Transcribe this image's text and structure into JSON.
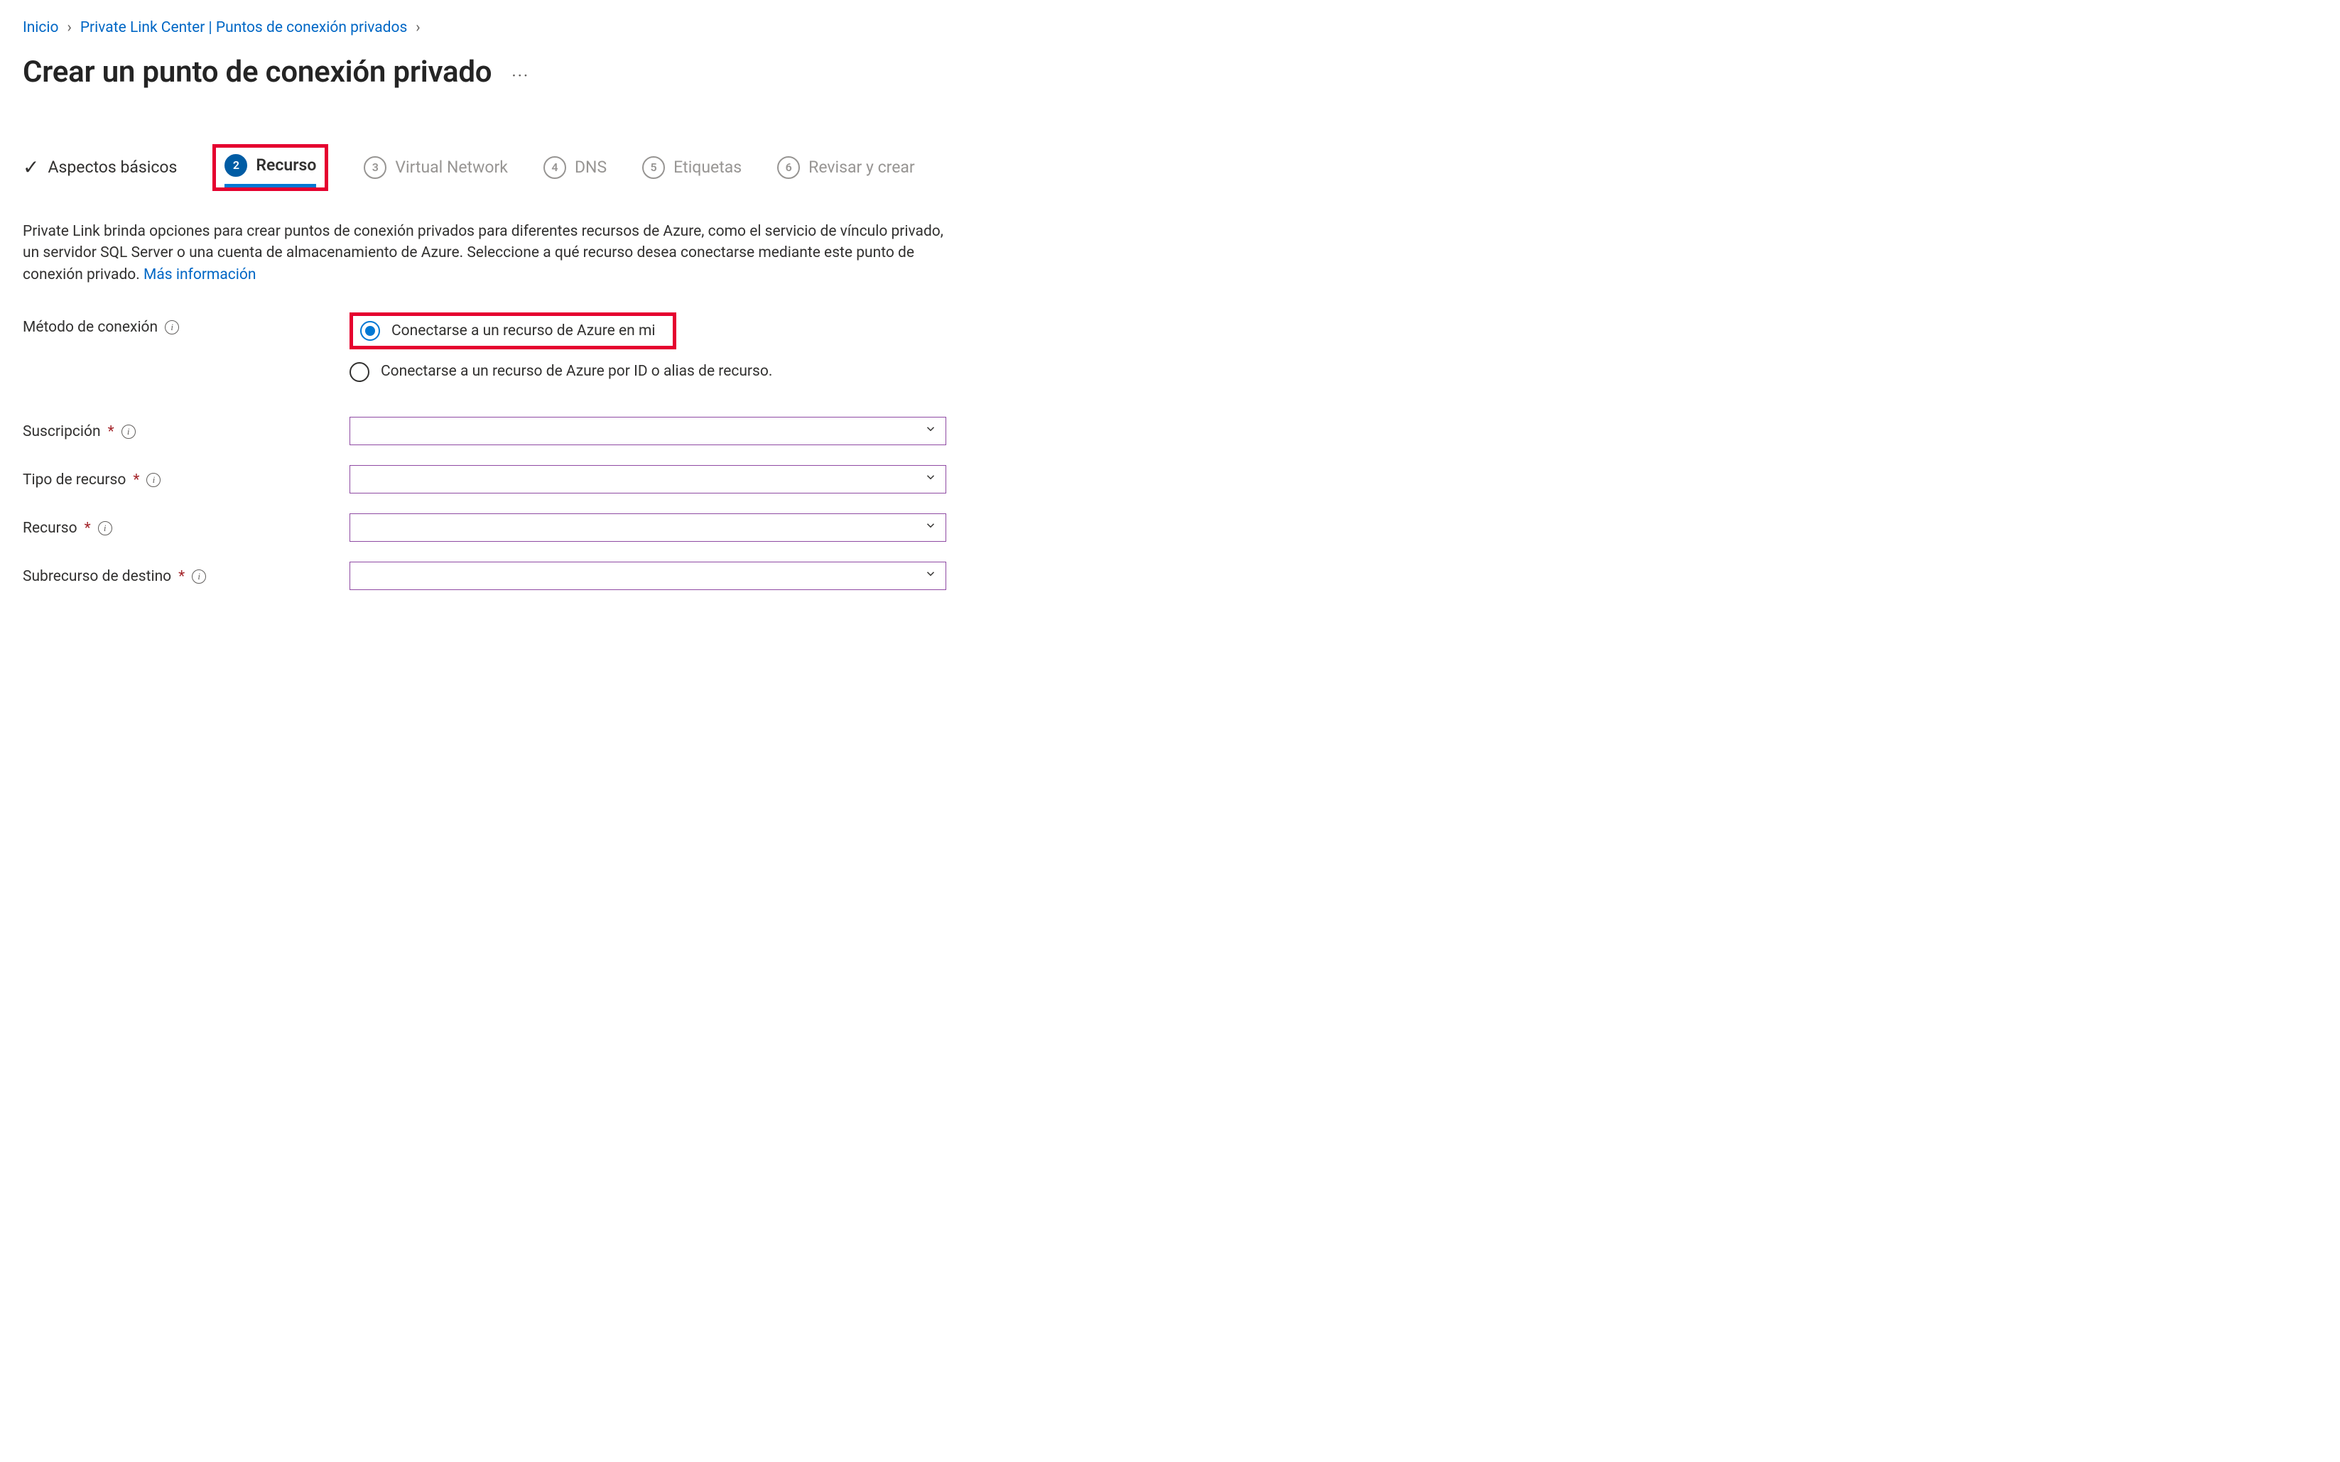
{
  "breadcrumb": {
    "home": "Inicio",
    "private_link": "Private Link Center | Puntos de conexión privados"
  },
  "page_title": "Crear un punto de conexión privado",
  "ellipsis": "···",
  "wizard": {
    "step1": "Aspectos básicos",
    "step2_num": "2",
    "step2": "Recurso",
    "step3_num": "3",
    "step3": "Virtual Network",
    "step4_num": "4",
    "step4": "DNS",
    "step5_num": "5",
    "step5": "Etiquetas",
    "step6_num": "6",
    "step6": "Revisar y crear"
  },
  "description_text": "Private Link brinda opciones para crear puntos de conexión privados para diferentes recursos de Azure, como el servicio de vínculo privado, un servidor SQL Server o una cuenta de almacenamiento de Azure. Seleccione a qué recurso desea conectarse mediante este punto de conexión privado. ",
  "description_link": "Más información",
  "form": {
    "connection_method": {
      "label": "Método de conexión",
      "option1": "Conectarse a un recurso de Azure en mi",
      "option2": "Conectarse a un recurso de Azure por ID o alias de recurso."
    },
    "subscription": {
      "label": "Suscripción",
      "value": ""
    },
    "resource_type": {
      "label": "Tipo de recurso",
      "value": ""
    },
    "resource": {
      "label": "Recurso",
      "value": ""
    },
    "target_subresource": {
      "label": "Subrecurso de destino",
      "value": ""
    }
  },
  "icons": {
    "info": "i",
    "chevron_down": "⌄",
    "check": "✓"
  }
}
